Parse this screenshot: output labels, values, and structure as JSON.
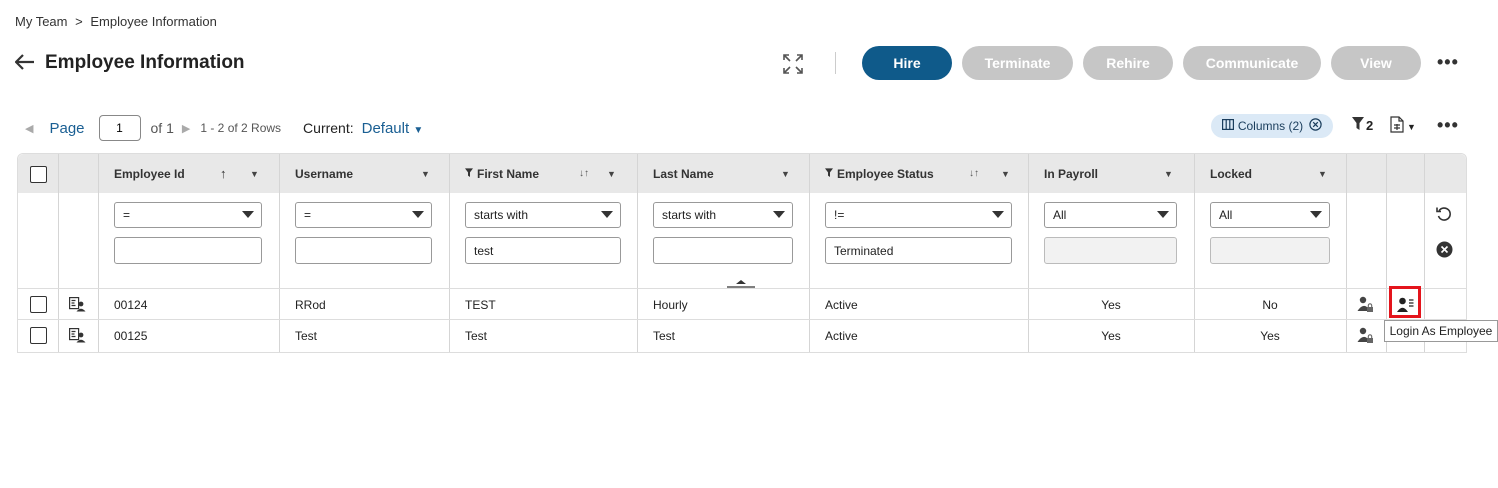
{
  "breadcrumb": {
    "parent": "My Team",
    "sep": ">",
    "current": "Employee Information"
  },
  "page": {
    "title": "Employee Information",
    "back_icon": "arrow-left-icon"
  },
  "toolbar": {
    "expand_icon": "expand-icon",
    "hire": "Hire",
    "terminate": "Terminate",
    "rehire": "Rehire",
    "communicate": "Communicate",
    "view": "View",
    "more": "•••"
  },
  "pager": {
    "label": "Page",
    "page_value": "1",
    "of_total": "of 1",
    "rows_info": "1 - 2 of 2 Rows",
    "current_label": "Current:",
    "current_value": "Default"
  },
  "right_tools": {
    "columns_chip": "Columns (2)",
    "filter_count": "2",
    "more": "•••"
  },
  "columns": {
    "employee_id": "Employee Id",
    "username": "Username",
    "first_name": "First Name",
    "last_name": "Last Name",
    "employee_status": "Employee Status",
    "in_payroll": "In Payroll",
    "locked": "Locked"
  },
  "filters": {
    "employee_id": {
      "op": "=",
      "value": ""
    },
    "username": {
      "op": "=",
      "value": ""
    },
    "first_name": {
      "op": "starts with",
      "value": "test"
    },
    "last_name": {
      "op": "starts with",
      "value": ""
    },
    "employee_status": {
      "op": "!=",
      "value": "Terminated"
    },
    "in_payroll": {
      "op": "All",
      "value": ""
    },
    "locked": {
      "op": "All",
      "value": ""
    }
  },
  "rows": [
    {
      "employee_id": "00124",
      "username": "RRod",
      "first_name": "TEST",
      "last_name": "Hourly",
      "status": "Active",
      "in_payroll": "Yes",
      "locked": "No"
    },
    {
      "employee_id": "00125",
      "username": "Test",
      "first_name": "Test",
      "last_name": "Test",
      "status": "Active",
      "in_payroll": "Yes",
      "locked": "Yes"
    }
  ],
  "tooltip": "Login As Employee",
  "colors": {
    "primary": "#0f5a8a",
    "disabled": "#c6c6c6",
    "link": "#1a5f93",
    "highlight": "#e4141c"
  }
}
